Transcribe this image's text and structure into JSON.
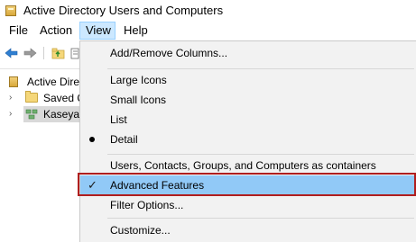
{
  "window": {
    "title": "Active Directory Users and Computers"
  },
  "menubar": {
    "items": [
      {
        "label": "File"
      },
      {
        "label": "Action"
      },
      {
        "label": "View"
      },
      {
        "label": "Help"
      }
    ]
  },
  "tree": {
    "root_label": "Active Directo",
    "items": [
      {
        "label": "Saved Q"
      },
      {
        "label": "Kaseya."
      }
    ]
  },
  "view_menu": {
    "items": [
      {
        "label": "Add/Remove Columns..."
      },
      {
        "label": "Large Icons"
      },
      {
        "label": "Small Icons"
      },
      {
        "label": "List"
      },
      {
        "label": "Detail",
        "state": "radio-selected"
      },
      {
        "label": "Users, Contacts, Groups, and Computers as containers"
      },
      {
        "label": "Advanced Features",
        "state": "checked",
        "highlighted": true
      },
      {
        "label": "Filter Options..."
      },
      {
        "label": "Customize..."
      }
    ]
  },
  "colors": {
    "menu_background": "#f2f2f2",
    "highlight": "#91c9f7",
    "open_menu": "#cce8ff",
    "annotation_frame": "#b01e1e"
  }
}
